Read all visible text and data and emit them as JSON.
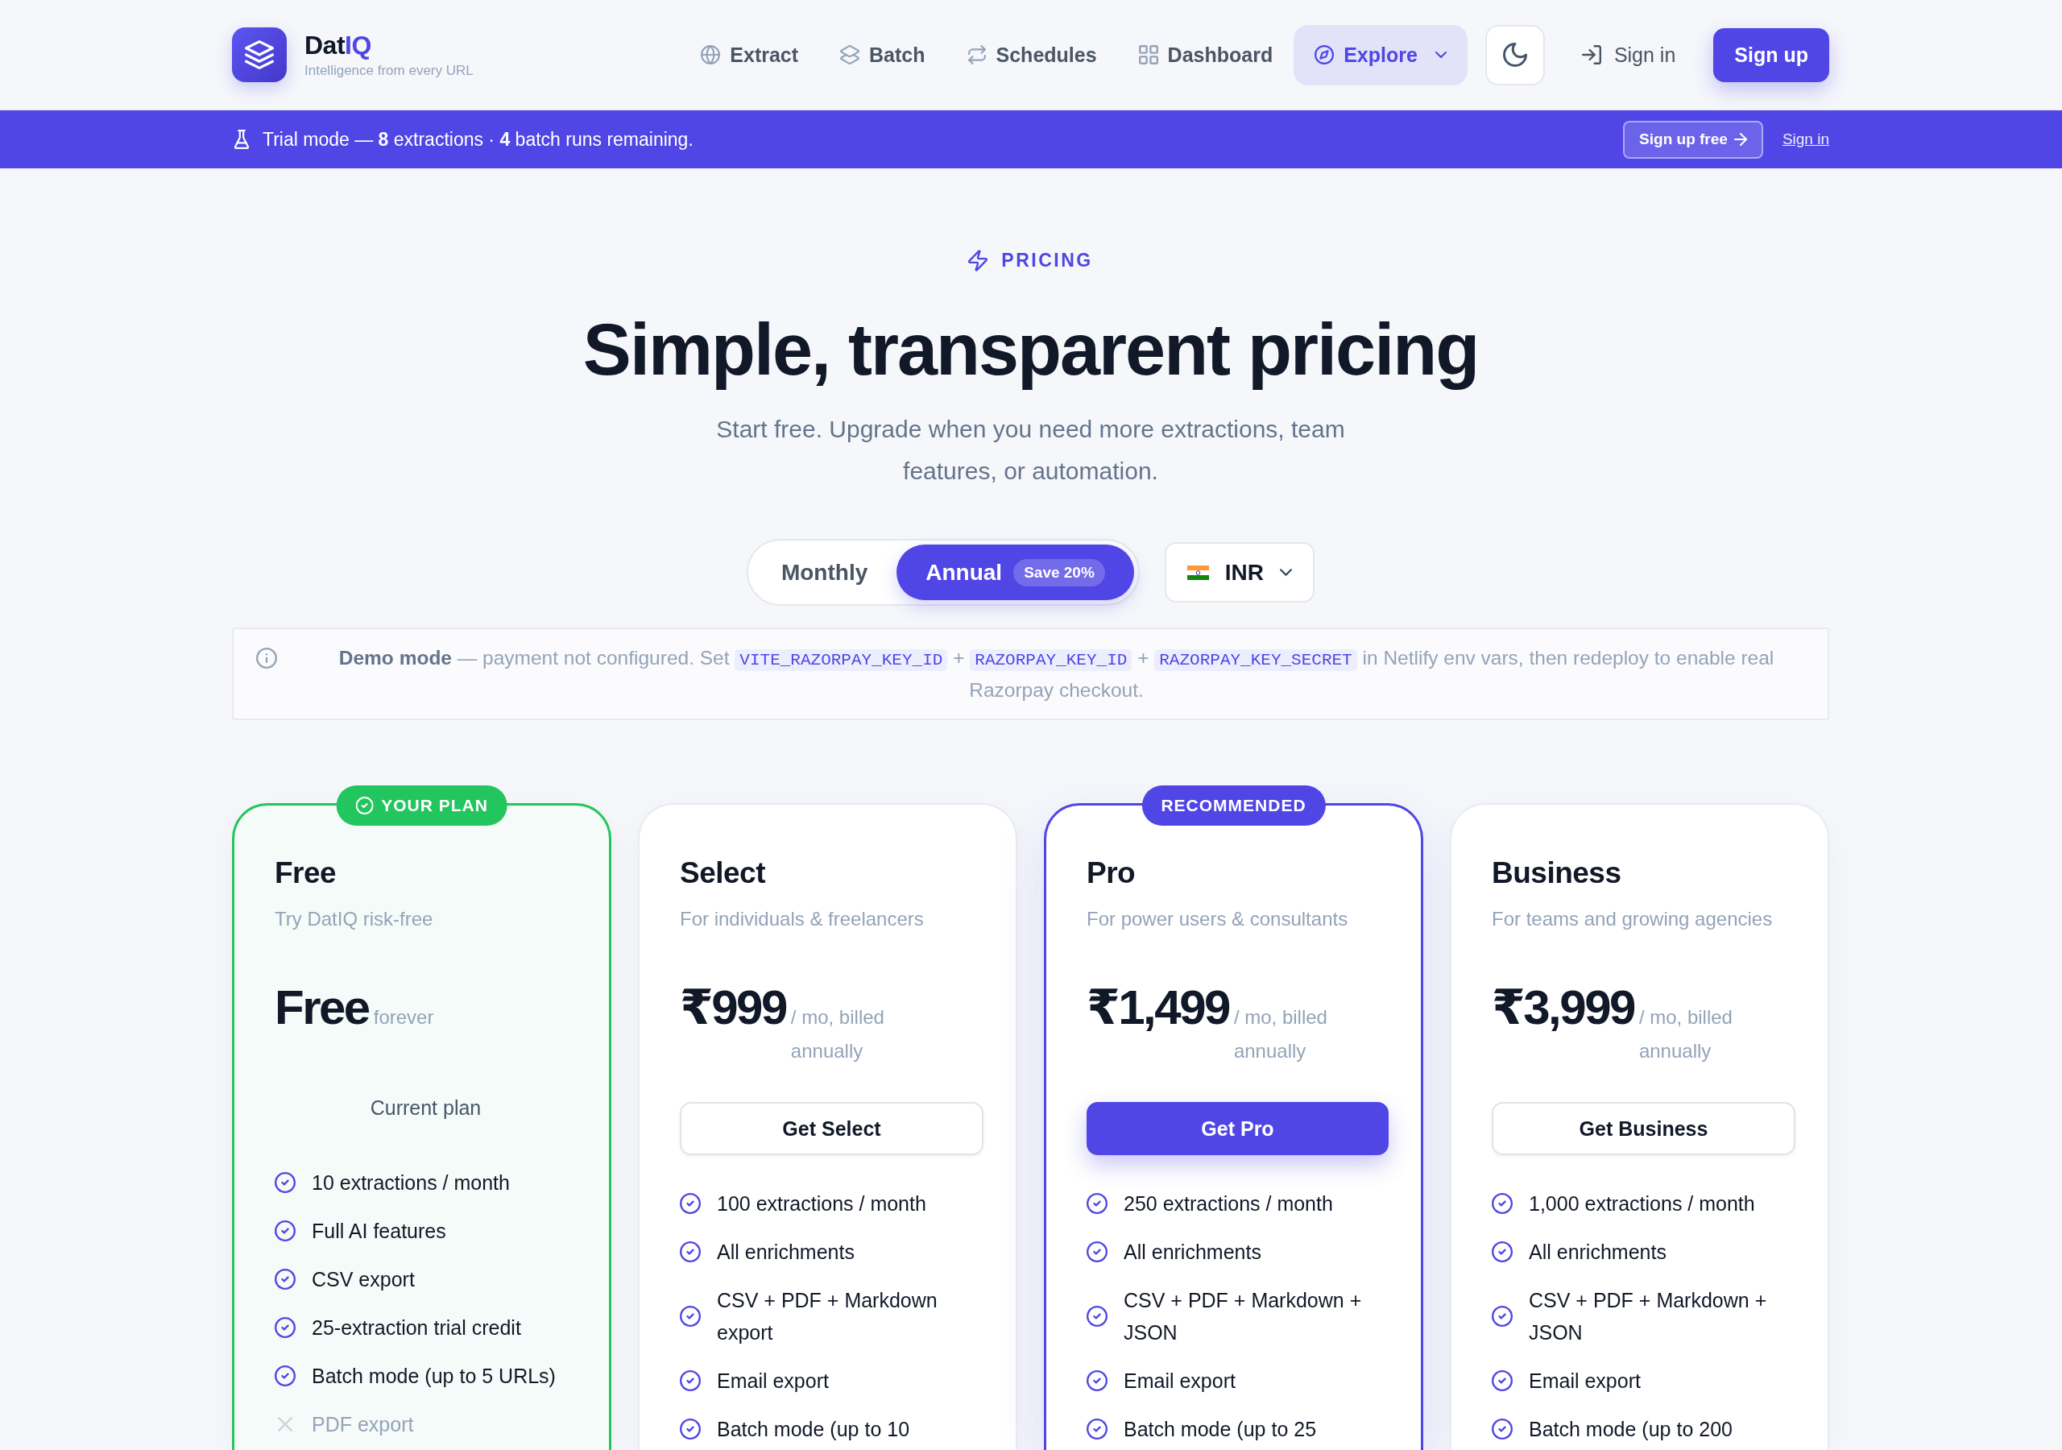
{
  "header": {
    "brand": {
      "name": [
        {
          "text": "Dat",
          "accent": false
        },
        {
          "text": "IQ",
          "accent": true
        }
      ],
      "tagline": "Intelligence from every URL"
    },
    "nav": [
      {
        "label": "Extract",
        "kind": "link",
        "selected": false
      },
      {
        "label": "Batch",
        "kind": "link",
        "selected": false
      },
      {
        "label": "Schedules",
        "kind": "link",
        "selected": false
      },
      {
        "label": "Dashboard",
        "kind": "link",
        "selected": false
      },
      {
        "label": "Explore",
        "kind": "menu",
        "selected": true
      }
    ],
    "sign_in": "Sign in",
    "sign_up": "Sign up"
  },
  "trial_banner": {
    "message": "Trial mode — **8** extractions · **4** batch runs remaining.",
    "cta": "Sign up free",
    "link": "Sign in"
  },
  "pricing": {
    "eyebrow": "PRICING",
    "title": "Simple, transparent pricing",
    "subtitle": "Start free. Upgrade when you need more extractions, team features, or automation.",
    "billing": [
      {
        "label": "Monthly",
        "selected": false
      },
      {
        "label": "Annual",
        "selected": true,
        "badge": "Save 20%"
      }
    ],
    "currency": "INR",
    "notice": [
      {
        "kind": "text",
        "text": "**Demo mode** — payment not configured. Set "
      },
      {
        "kind": "code",
        "text": "VITE_RAZORPAY_KEY_ID"
      },
      {
        "kind": "text",
        "text": " + "
      },
      {
        "kind": "code",
        "text": "RAZORPAY_KEY_ID"
      },
      {
        "kind": "text",
        "text": " + "
      },
      {
        "kind": "code",
        "text": "RAZORPAY_KEY_SECRET"
      },
      {
        "kind": "text",
        "text": " in Netlify env vars, then redeploy to enable real Razorpay checkout."
      }
    ],
    "plans": [
      {
        "name": "Free",
        "description": "Try DatIQ risk-free",
        "price": "Free",
        "period": "forever",
        "badge": {
          "kind": "current",
          "label": "YOUR PLAN"
        },
        "action": {
          "kind": "status",
          "label": "Current plan"
        },
        "features": [
          {
            "text": "10 extractions / month",
            "included": true
          },
          {
            "text": "Full AI features",
            "included": true
          },
          {
            "text": "CSV export",
            "included": true
          },
          {
            "text": "25-extraction trial credit",
            "included": true
          },
          {
            "text": "Batch mode (up to 5 URLs)",
            "included": true
          },
          {
            "text": "PDF export",
            "included": false
          }
        ]
      },
      {
        "name": "Select",
        "description": "For individuals & freelancers",
        "price": "₹999",
        "period": "/ mo, billed annually",
        "action": {
          "kind": "outline",
          "label": "Get Select"
        },
        "features": [
          {
            "text": "100 extractions / month",
            "included": true
          },
          {
            "text": "All enrichments",
            "included": true
          },
          {
            "text": "CSV + PDF + Markdown export",
            "included": true
          },
          {
            "text": "Email export",
            "included": true
          },
          {
            "text": "Batch mode (up to 10",
            "included": true
          }
        ]
      },
      {
        "name": "Pro",
        "description": "For power users & consultants",
        "price": "₹1,499",
        "period": "/ mo, billed annually",
        "badge": {
          "kind": "recommended",
          "label": "RECOMMENDED"
        },
        "action": {
          "kind": "primary",
          "label": "Get Pro"
        },
        "features": [
          {
            "text": "250 extractions / month",
            "included": true
          },
          {
            "text": "All enrichments",
            "included": true
          },
          {
            "text": "CSV + PDF + Markdown + JSON",
            "included": true
          },
          {
            "text": "Email export",
            "included": true
          },
          {
            "text": "Batch mode (up to 25",
            "included": true
          }
        ]
      },
      {
        "name": "Business",
        "description": "For teams and growing agencies",
        "price": "₹3,999",
        "period": "/ mo, billed annually",
        "action": {
          "kind": "outline",
          "label": "Get Business"
        },
        "features": [
          {
            "text": "1,000 extractions / month",
            "included": true
          },
          {
            "text": "All enrichments",
            "included": true
          },
          {
            "text": "CSV + PDF + Markdown + JSON",
            "included": true
          },
          {
            "text": "Email export",
            "included": true
          },
          {
            "text": "Batch mode (up to 200",
            "included": true
          }
        ]
      }
    ]
  }
}
